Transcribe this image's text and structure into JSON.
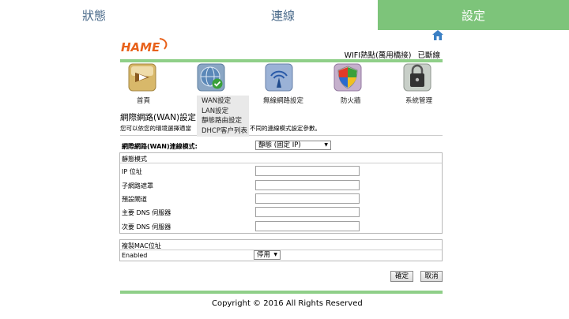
{
  "top_nav": {
    "status": "狀態",
    "connection": "連線",
    "settings": "設定"
  },
  "header": {
    "logo_text": "HAME",
    "wifi_status_label": "WIFI熱點(萬用橋接)",
    "connection_state": "已斷線"
  },
  "nav_items": [
    {
      "label": "首頁"
    },
    {
      "label": "網際網路"
    },
    {
      "label": "無線網路設定"
    },
    {
      "label": "防火牆"
    },
    {
      "label": "系統管理"
    }
  ],
  "dropdown_items": [
    "WAN設定",
    "LAN設定",
    "靜態路由設定",
    "DHCP客户列表"
  ],
  "section": {
    "title": "網際網路(WAN)設定",
    "desc_left": "您可以依您的環境選擇適當",
    "desc_right": "不同的連線模式設定參數。"
  },
  "wan_mode": {
    "label": "網際網路(WAN)連線模式:",
    "value": "靜態 (固定 IP)"
  },
  "static_mode": {
    "heading": "靜態模式",
    "fields": [
      {
        "label": "IP 位址",
        "value": ""
      },
      {
        "label": "子網路遮罩",
        "value": ""
      },
      {
        "label": "預設閘道",
        "value": ""
      },
      {
        "label": "主要 DNS 伺服器",
        "value": ""
      },
      {
        "label": "次要 DNS 伺服器",
        "value": ""
      }
    ]
  },
  "mac_clone": {
    "heading": "複製MAC位址",
    "enabled_label": "Enabled",
    "value": "停用"
  },
  "buttons": {
    "apply": "確定",
    "cancel": "取消"
  },
  "footer": {
    "copyright": "Copyright © 2016 All Rights Reserved"
  },
  "colors": {
    "accent_green": "#7dc47a",
    "nav_text": "#4a6a8a",
    "logo_orange": "#e8611a"
  }
}
